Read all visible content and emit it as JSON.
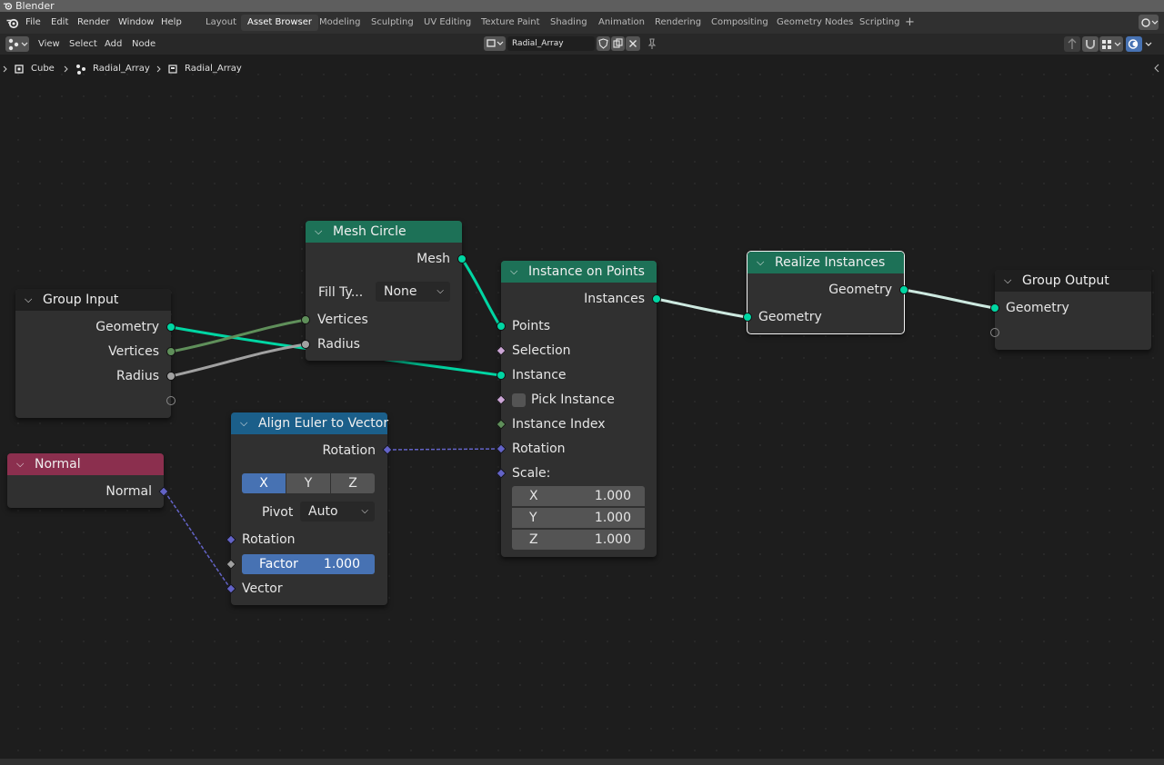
{
  "window": {
    "title": "Blender"
  },
  "topbar": {
    "menus": [
      "File",
      "Edit",
      "Render",
      "Window",
      "Help"
    ],
    "workspaces": [
      "Layout",
      "Asset Browser",
      "Modeling",
      "Sculpting",
      "UV Editing",
      "Texture Paint",
      "Shading",
      "Animation",
      "Rendering",
      "Compositing",
      "Geometry Nodes",
      "Scripting"
    ],
    "active_workspace": "Asset Browser",
    "add_workspace": "+"
  },
  "toolbar": {
    "menus": [
      "View",
      "Select",
      "Add",
      "Node"
    ],
    "node_group_name": "Radial_Array"
  },
  "breadcrumb": [
    "Cube",
    "Radial_Array",
    "Radial_Array"
  ],
  "nodes": {
    "group_input": {
      "title": "Group Input",
      "outputs": [
        "Geometry",
        "Vertices",
        "Radius"
      ]
    },
    "mesh_circle": {
      "title": "Mesh Circle",
      "output": "Mesh",
      "fill_type_label": "Fill Ty...",
      "fill_type_value": "None",
      "inputs": [
        "Vertices",
        "Radius"
      ]
    },
    "normal": {
      "title": "Normal",
      "output": "Normal"
    },
    "align_euler": {
      "title": "Align Euler to Vector",
      "output": "Rotation",
      "axes": [
        "X",
        "Y",
        "Z"
      ],
      "active_axis": "X",
      "pivot_label": "Pivot",
      "pivot_value": "Auto",
      "inputs": [
        "Rotation",
        "Vector"
      ],
      "factor_label": "Factor",
      "factor_value": "1.000"
    },
    "instance_on_points": {
      "title": "Instance on Points",
      "output": "Instances",
      "inputs": [
        "Points",
        "Selection",
        "Instance",
        "Pick Instance",
        "Instance Index",
        "Rotation",
        "Scale:"
      ],
      "scale": [
        {
          "axis": "X",
          "value": "1.000"
        },
        {
          "axis": "Y",
          "value": "1.000"
        },
        {
          "axis": "Z",
          "value": "1.000"
        }
      ]
    },
    "realize_instances": {
      "title": "Realize Instances",
      "output": "Geometry",
      "input": "Geometry"
    },
    "group_output": {
      "title": "Group Output",
      "input": "Geometry"
    }
  },
  "colors": {
    "geometry": "#00d6a3",
    "integer": "#5f8f5a",
    "float": "#a1a1a1",
    "vector": "#6363c7",
    "boolean": "#cca6d6",
    "header_geometry": "#1d7157",
    "header_converter": "#1b5f8a",
    "header_input": "#8b2f4e",
    "selection_blue": "#4772b3"
  }
}
